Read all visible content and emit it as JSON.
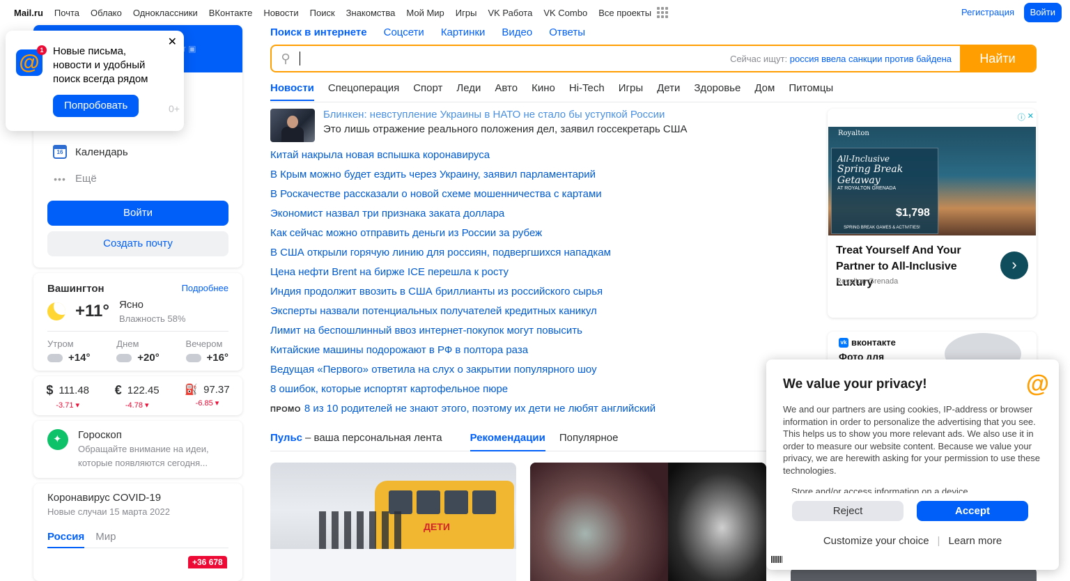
{
  "topbar": {
    "brand": "Mail.ru",
    "items": [
      "Почта",
      "Облако",
      "Одноклассники",
      "ВКонтакте",
      "Новости",
      "Поиск",
      "Знакомства",
      "Мой Мир",
      "Игры",
      "VK Работа",
      "VK Combo",
      "Все проекты"
    ],
    "register": "Регистрация",
    "login": "Войти"
  },
  "popup": {
    "badge": "1",
    "text": "Новые письма, новости и удобный поиск всегда рядом",
    "button": "Попробовать",
    "age": "0+",
    "close": "✕"
  },
  "login_card": {
    "calendar": "Календарь",
    "calendar_day": "16",
    "more": "Ещё",
    "enter": "Войти",
    "create": "Создать почту"
  },
  "weather": {
    "city": "Вашингтон",
    "more": "Подробнее",
    "temp": "+11°",
    "condition": "Ясно",
    "humidity": "Влажность 58%",
    "parts": [
      {
        "label": "Утром",
        "temp": "+14°"
      },
      {
        "label": "Днем",
        "temp": "+20°"
      },
      {
        "label": "Вечером",
        "temp": "+16°"
      }
    ]
  },
  "currency": [
    {
      "symbol": "$",
      "value": "111.48",
      "change": "-3.71 ▾"
    },
    {
      "symbol": "€",
      "value": "122.45",
      "change": "-4.78 ▾"
    },
    {
      "symbol": "⛽",
      "value": "97.37",
      "change": "-6.85 ▾"
    }
  ],
  "horoscope": {
    "title": "Гороскоп",
    "text": "Обращайте внимание на идеи, которые появляются сегодня..."
  },
  "covid": {
    "title": "Коронавирус COVID-19",
    "subtitle": "Новые случаи 15 марта 2022",
    "tabs": [
      "Россия",
      "Мир"
    ],
    "badge": "+36 678"
  },
  "search": {
    "tabs": [
      "Поиск в интернете",
      "Соцсети",
      "Картинки",
      "Видео",
      "Ответы"
    ],
    "hint_label": "Сейчас ищут:",
    "hint_query": "россия ввела санкции против байдена",
    "button": "Найти",
    "value": ""
  },
  "news_tabs": [
    "Новости",
    "Спецоперация",
    "Спорт",
    "Леди",
    "Авто",
    "Кино",
    "Hi-Tech",
    "Игры",
    "Дети",
    "Здоровье",
    "Дом",
    "Питомцы"
  ],
  "lead_news": {
    "headline": "Блинкен: невступление Украины в НАТО не стало бы уступкой России",
    "description": "Это лишь отражение реального положения дел, заявил госсекретарь США"
  },
  "news": [
    "Китай накрыла новая вспышка коронавируса",
    "В Крым можно будет ездить через Украину, заявил парламентарий",
    "В Роскачестве рассказали о новой схеме мошенничества с картами",
    "Экономист назвал три признака заката доллара",
    "Как сейчас можно отправить деньги из России за рубеж",
    "В США открыли горячую линию для россиян, подвергшихся нападкам",
    "Цена нефти Brent на бирже ICE перешла к росту",
    "Индия продолжит ввозить в США бриллианты из российского сырья",
    "Эксперты назвали потенциальных получателей кредитных каникул",
    "Лимит на беспошлинный ввоз интернет-покупок могут повысить",
    "Китайские машины подорожают в РФ в полтора раза",
    "Ведущая «Первого» ответила на слух о закрытии популярного шоу",
    "8 ошибок, которые испортят картофельное пюре"
  ],
  "promo": {
    "tag": "ПРОМО",
    "text": "8 из 10 родителей не знают этого, поэтому их дети не любят английский"
  },
  "feed": {
    "pulse": "Пульс",
    "pulse_sub": "– ваша персональная лента",
    "tabs": [
      "Рекомендации",
      "Популярное"
    ],
    "bus_label": "ДЕТИ"
  },
  "ad": {
    "brand": "Royalton",
    "panel_line1": "All-Inclusive",
    "panel_line2": "Spring Break Getaway",
    "panel_line3": "AT ROYALTON GRENADA",
    "price": "$1,798",
    "footer": "SPRING BREAK GAMES & ACTIVITIES!",
    "title": "Treat Yourself And Your Partner to All-Inclusive Luxury",
    "advertiser": "Royalton Grenada",
    "arrow": "›"
  },
  "vk_promo": {
    "logo": "вконтакте",
    "text": "Фото для"
  },
  "privacy": {
    "title": "We value your privacy!",
    "text": "We and our partners are using cookies, IP-address or browser information in order to personalize the advertising that you see. This helps us to show you more relevant ads. We also use it in order to measure our website content. Because we value your privacy, we are herewith asking for your permission to use these technologies.",
    "store": "Store and/or access information on a device",
    "reject": "Reject",
    "accept": "Accept",
    "customize": "Customize your choice",
    "learn": "Learn more"
  },
  "colors": {
    "accent": "#005ff9",
    "search_orange": "#ff9e00",
    "negative": "#ed0a34"
  }
}
